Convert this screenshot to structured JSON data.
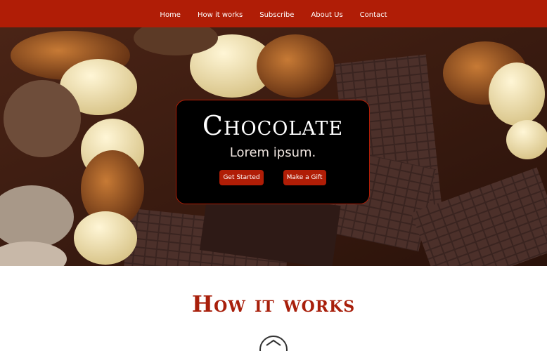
{
  "nav": {
    "items": [
      {
        "label": "Home"
      },
      {
        "label": "How it works"
      },
      {
        "label": "Subscribe"
      },
      {
        "label": "About Us"
      },
      {
        "label": "Contact"
      }
    ]
  },
  "hero": {
    "title": "Chocolate",
    "subtitle": "Lorem ipsum.",
    "primary_button": "Get Started",
    "secondary_button": "Make a Gift"
  },
  "how_it_works": {
    "title": "How it works",
    "icon": "badge-icon"
  },
  "colors": {
    "accent": "#b01d06",
    "title": "#a81f0b",
    "hero_box": "#000000"
  }
}
